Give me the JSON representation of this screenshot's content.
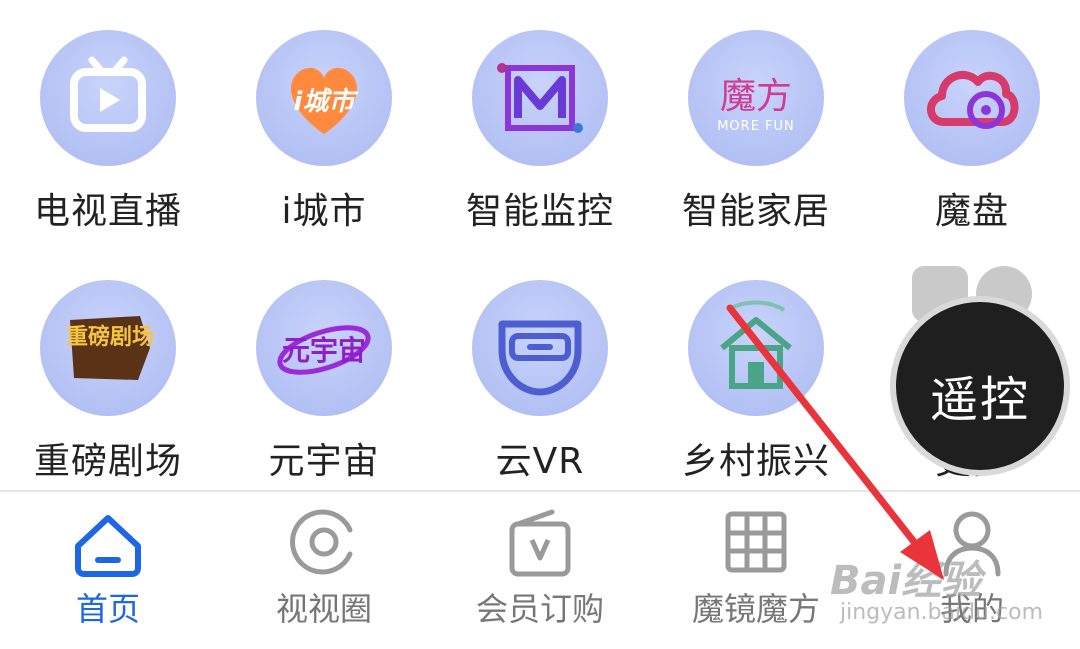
{
  "apps": [
    {
      "label": "电视直播",
      "icon": "tv-live-icon"
    },
    {
      "label": "i城市",
      "icon": "icity-icon",
      "icon_text": "i城市"
    },
    {
      "label": "智能监控",
      "icon": "smart-monitor-icon"
    },
    {
      "label": "智能家居",
      "icon": "smart-home-icon",
      "icon_text": "魔方",
      "icon_subtext": "MORE FUN"
    },
    {
      "label": "魔盘",
      "icon": "cloud-disk-icon"
    },
    {
      "label": "重磅剧场",
      "icon": "theater-icon",
      "icon_text": "重磅剧场"
    },
    {
      "label": "元宇宙",
      "icon": "metaverse-icon",
      "icon_text": "元宇宙"
    },
    {
      "label": "云VR",
      "icon": "vr-headset-icon"
    },
    {
      "label": "乡村振兴",
      "icon": "rural-house-icon"
    },
    {
      "label": "更多",
      "icon": "more-icon"
    }
  ],
  "floating_button": {
    "label": "遥控"
  },
  "tabs": [
    {
      "label": "首页",
      "icon": "home-icon",
      "active": true
    },
    {
      "label": "视视圈",
      "icon": "circle-target-icon",
      "active": false
    },
    {
      "label": "会员订购",
      "icon": "vip-wallet-icon",
      "active": false
    },
    {
      "label": "魔镜魔方",
      "icon": "grid-icon",
      "active": false
    },
    {
      "label": "我的",
      "icon": "user-icon",
      "active": false
    }
  ],
  "watermark": {
    "text": "Bai经验",
    "subtext": "jingyan.baidu.com"
  },
  "colors": {
    "active_tab": "#1f66e5",
    "inactive_tab": "#777777",
    "icon_bg": "#b3c1f4",
    "arrow": "#e8343a"
  }
}
